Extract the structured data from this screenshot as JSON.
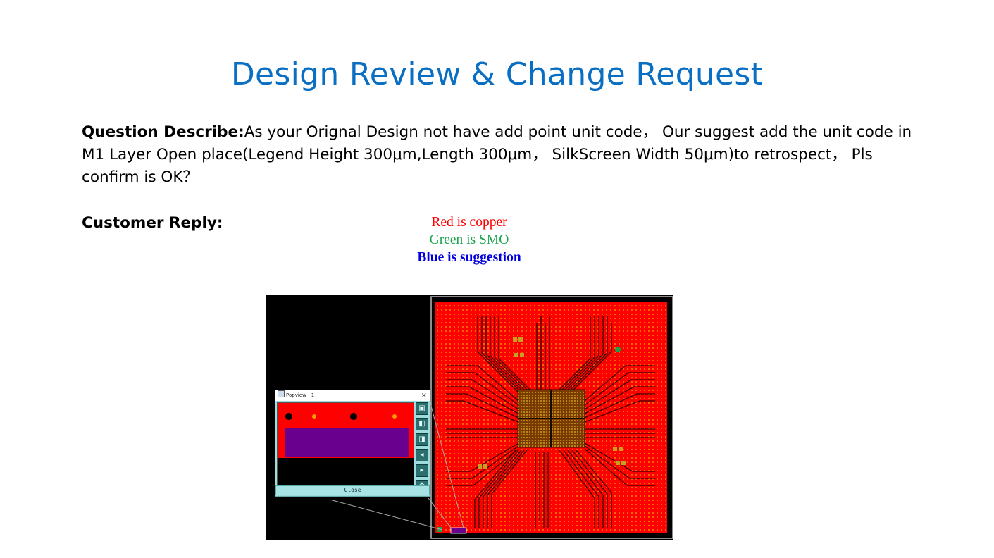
{
  "title": "Design Review & Change Request",
  "question": {
    "label": "Question Describe:",
    "text": "As your Orignal Design not have add point unit code， Our suggest add the unit code in M1 Layer Open place(Legend Height 300μm,Length 300μm， SilkScreen Width 50μm)to retrospect， Pls confirm is OK？"
  },
  "reply": {
    "label": "Customer Reply:"
  },
  "legend": {
    "red": "Red is copper",
    "green": "Green is SMO",
    "blue": "Blue is suggestion"
  },
  "popview": {
    "title": "Popview - 1",
    "close_x": "×",
    "close_label": "Close",
    "buttons": [
      "zoom-fit-icon",
      "zoom-in-icon",
      "zoom-out-icon",
      "pan-left-icon",
      "pan-right-icon",
      "full-view-icon"
    ]
  },
  "colors": {
    "title": "#0a6fc2",
    "copper": "#ff0000",
    "smo": "#1aa34a",
    "suggestion": "#0000dd",
    "suggestion_fill": "#6a008e",
    "popview_frame": "#9fdcdc"
  }
}
